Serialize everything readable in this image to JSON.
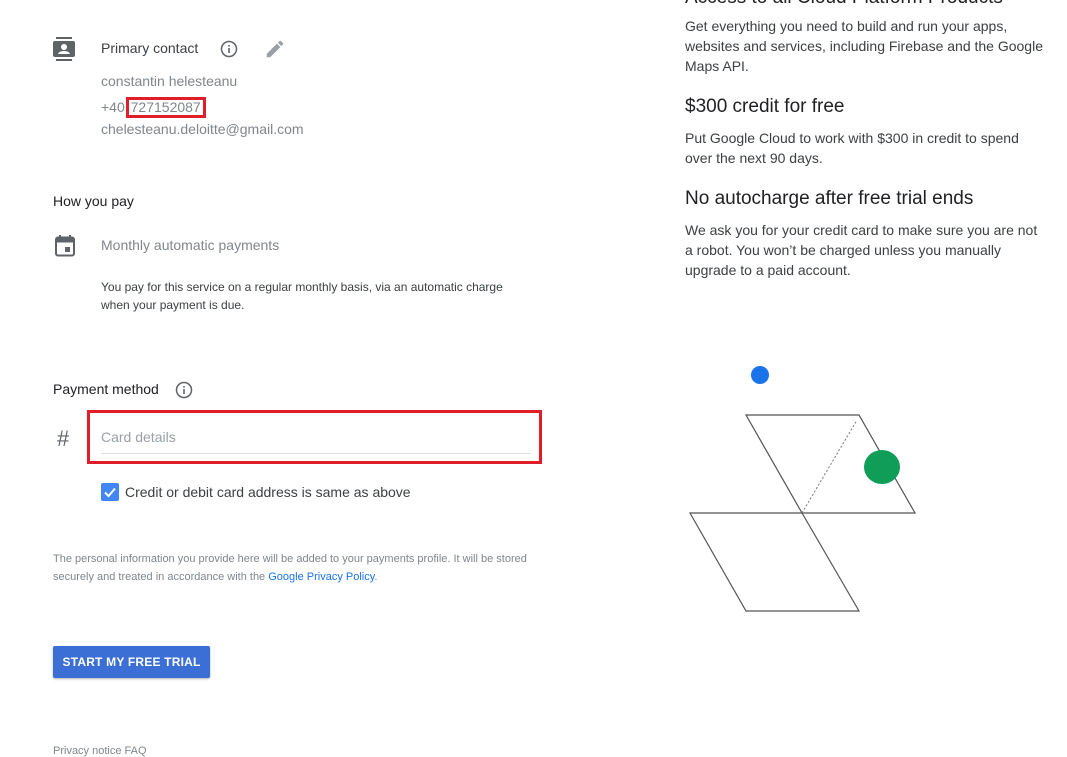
{
  "contact": {
    "title": "Primary contact",
    "name": "constantin helesteanu",
    "phone_prefix": "+40",
    "phone_number": "727152087",
    "email": "chelesteanu.deloitte@gmail.com"
  },
  "payment_type": {
    "heading": "How you pay",
    "title": "Monthly automatic payments",
    "description": "You pay for this service on a regular monthly basis, via an automatic charge when your payment is due."
  },
  "payment_method": {
    "heading": "Payment method",
    "card_placeholder": "Card details",
    "checkbox_label": "Credit or debit card address is same as above",
    "checkbox_checked": true
  },
  "privacy": {
    "text": "The personal information you provide here will be added to your payments profile. It will be stored securely and treated in accordance with the ",
    "link": "Google Privacy Policy",
    "suffix": "."
  },
  "cta": {
    "label": "START MY FREE TRIAL"
  },
  "footer": {
    "cut_text": "Privacy notice FAQ"
  },
  "right": {
    "cut_heading": "Access to all Cloud Platform Products",
    "para1": "Get everything you need to build and run your apps, websites and services, including Firebase and the Google Maps API.",
    "heading2": "$300 credit for free",
    "para2": "Put Google Cloud to work with $300 in credit to spend over the next 90 days.",
    "heading3": "No autocharge after free trial ends",
    "para3": "We ask you for your credit card to make sure you are not a robot. You won’t be charged unless you manually upgrade to a paid account."
  },
  "colors": {
    "accent": "#3b6fd6",
    "highlight": "#e01e2a",
    "blue_dot": "#1a73e8",
    "green_dot": "#0f9d58"
  }
}
